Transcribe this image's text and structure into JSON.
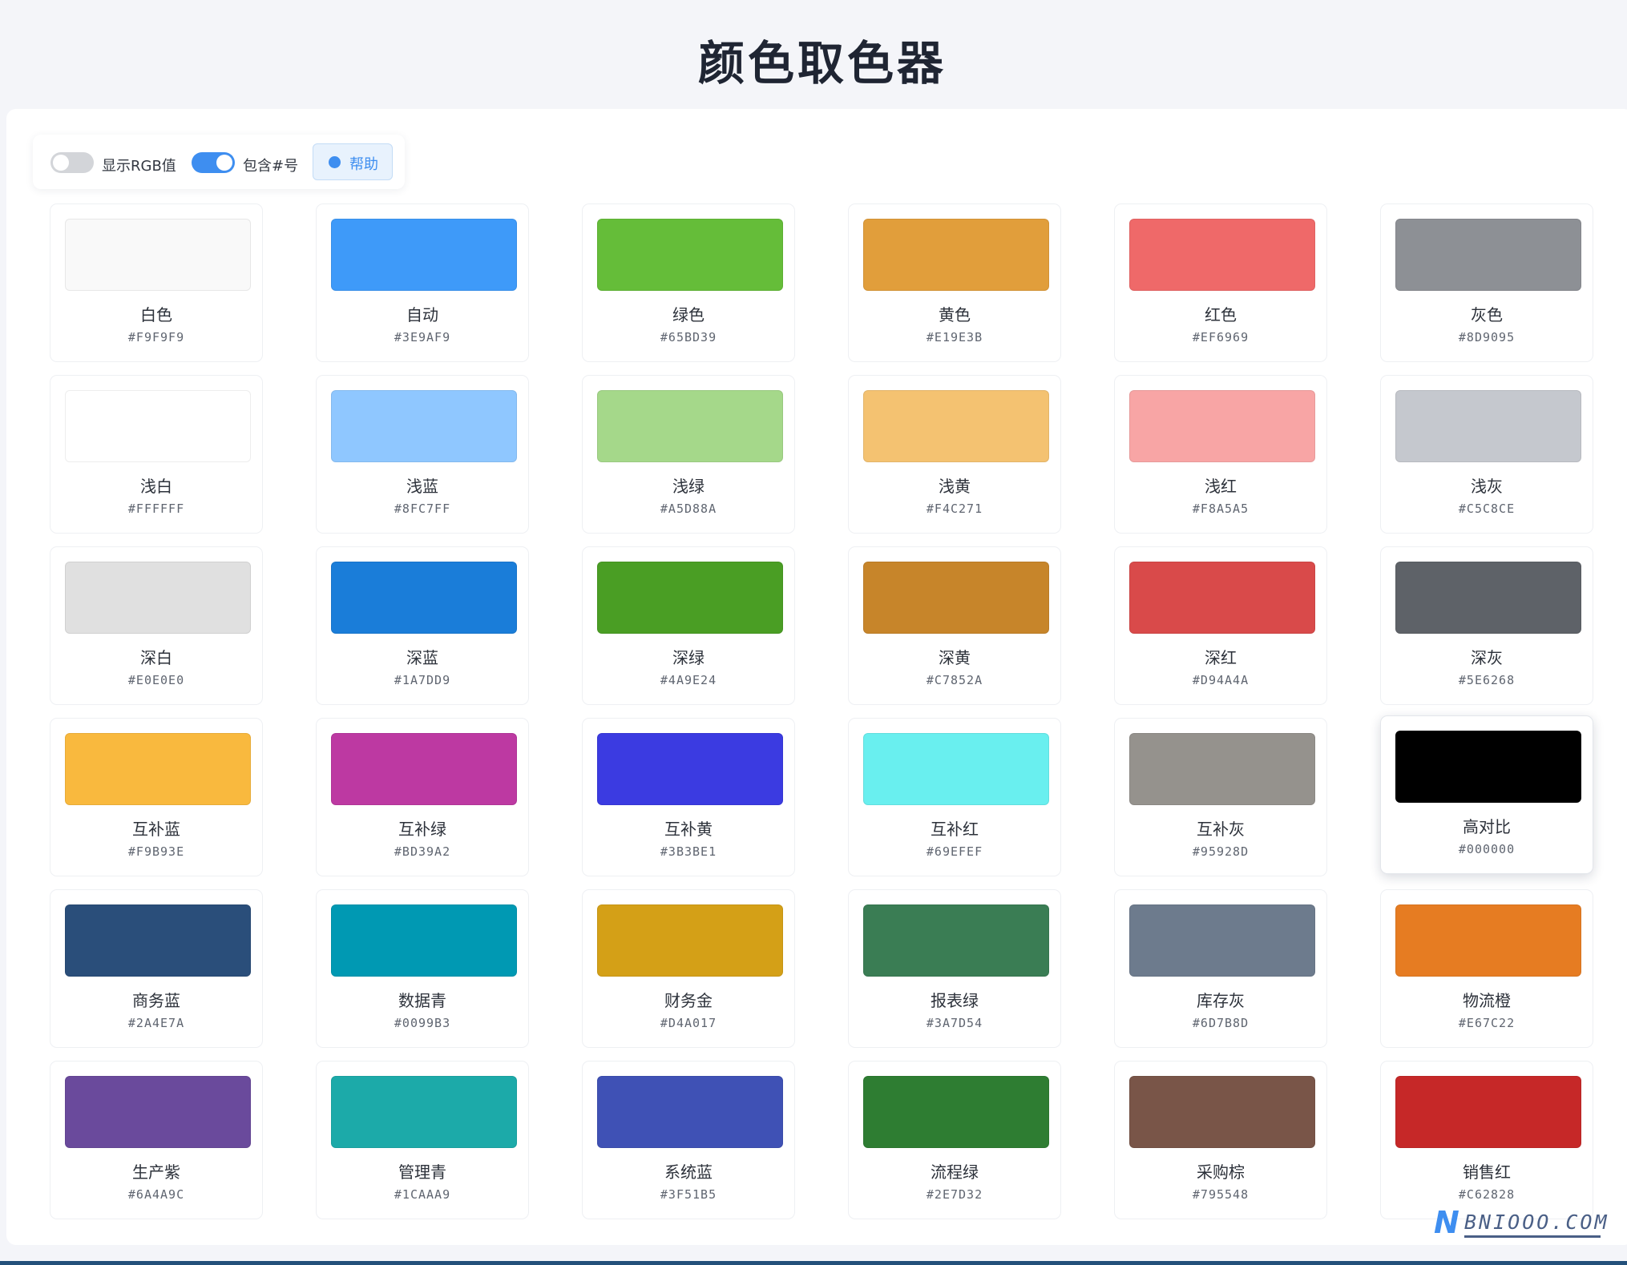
{
  "page": {
    "title": "颜色取色器"
  },
  "toolbar": {
    "show_rgb": {
      "label": "显示RGB值",
      "on": false
    },
    "include_hash": {
      "label": "包含#号",
      "on": true
    },
    "help_label": "帮助"
  },
  "swatches": [
    {
      "name": "白色",
      "hex": "#F9F9F9",
      "color": "#F9F9F9"
    },
    {
      "name": "自动",
      "hex": "#3E9AF9",
      "color": "#3E9AF9"
    },
    {
      "name": "绿色",
      "hex": "#65BD39",
      "color": "#65BD39"
    },
    {
      "name": "黄色",
      "hex": "#E19E3B",
      "color": "#E19E3B"
    },
    {
      "name": "红色",
      "hex": "#EF6969",
      "color": "#EF6969"
    },
    {
      "name": "灰色",
      "hex": "#8D9095",
      "color": "#8D9095"
    },
    {
      "name": "浅白",
      "hex": "#FFFFFF",
      "color": "#FFFFFF"
    },
    {
      "name": "浅蓝",
      "hex": "#8FC7FF",
      "color": "#8FC7FF"
    },
    {
      "name": "浅绿",
      "hex": "#A5D88A",
      "color": "#A5D88A"
    },
    {
      "name": "浅黄",
      "hex": "#F4C271",
      "color": "#F4C271"
    },
    {
      "name": "浅红",
      "hex": "#F8A5A5",
      "color": "#F8A5A5"
    },
    {
      "name": "浅灰",
      "hex": "#C5C8CE",
      "color": "#C5C8CE"
    },
    {
      "name": "深白",
      "hex": "#E0E0E0",
      "color": "#E0E0E0"
    },
    {
      "name": "深蓝",
      "hex": "#1A7DD9",
      "color": "#1A7DD9"
    },
    {
      "name": "深绿",
      "hex": "#4A9E24",
      "color": "#4A9E24"
    },
    {
      "name": "深黄",
      "hex": "#C7852A",
      "color": "#C7852A"
    },
    {
      "name": "深红",
      "hex": "#D94A4A",
      "color": "#D94A4A"
    },
    {
      "name": "深灰",
      "hex": "#5E6268",
      "color": "#5E6268"
    },
    {
      "name": "互补蓝",
      "hex": "#F9B93E",
      "color": "#F9B93E"
    },
    {
      "name": "互补绿",
      "hex": "#BD39A2",
      "color": "#BD39A2"
    },
    {
      "name": "互补黄",
      "hex": "#3B3BE1",
      "color": "#3B3BE1"
    },
    {
      "name": "互补红",
      "hex": "#69EFEF",
      "color": "#69EFEF"
    },
    {
      "name": "互补灰",
      "hex": "#95928D",
      "color": "#95928D"
    },
    {
      "name": "高对比",
      "hex": "#000000",
      "color": "#000000",
      "selected": true
    },
    {
      "name": "商务蓝",
      "hex": "#2A4E7A",
      "color": "#2A4E7A"
    },
    {
      "name": "数据青",
      "hex": "#0099B3",
      "color": "#0099B3"
    },
    {
      "name": "财务金",
      "hex": "#D4A017",
      "color": "#D4A017"
    },
    {
      "name": "报表绿",
      "hex": "#3A7D54",
      "color": "#3A7D54"
    },
    {
      "name": "库存灰",
      "hex": "#6D7B8D",
      "color": "#6D7B8D"
    },
    {
      "name": "物流橙",
      "hex": "#E67C22",
      "color": "#E67C22"
    },
    {
      "name": "生产紫",
      "hex": "#6A4A9C",
      "color": "#6A4A9C"
    },
    {
      "name": "管理青",
      "hex": "#1CAAA9",
      "color": "#1CAAA9"
    },
    {
      "name": "系统蓝",
      "hex": "#3F51B5",
      "color": "#3F51B5"
    },
    {
      "name": "流程绿",
      "hex": "#2E7D32",
      "color": "#2E7D32"
    },
    {
      "name": "采购棕",
      "hex": "#795548",
      "color": "#795548"
    },
    {
      "name": "销售红",
      "hex": "#C62828",
      "color": "#C62828"
    }
  ],
  "watermark": {
    "text": "BNIOOO.COM",
    "initial": "N"
  },
  "colors": {
    "accent": "#3E8EF0",
    "page_background": "#F4F5F9",
    "title": "#1F2533"
  }
}
